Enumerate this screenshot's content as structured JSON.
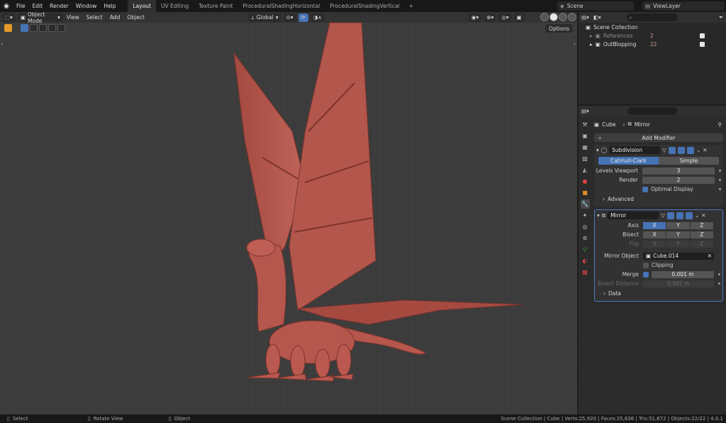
{
  "topbar": {
    "menus": [
      "File",
      "Edit",
      "Render",
      "Window",
      "Help"
    ],
    "workspaces": [
      "Layout",
      "UV Editing",
      "Texture Paint",
      "ProceduralShadingHorizontal",
      "ProceduralShadingVertical"
    ],
    "active_workspace": "Layout",
    "add_tab": "+",
    "scene": "Scene",
    "view_layer": "ViewLayer"
  },
  "viewport": {
    "mode": "Object Mode",
    "menus": [
      "View",
      "Select",
      "Add",
      "Object"
    ],
    "orientation": "Global",
    "options_label": "Options"
  },
  "outliner": {
    "root": "Scene Collection",
    "items": [
      {
        "label": "References",
        "dim": true,
        "badge": "2"
      },
      {
        "label": "OutBlopping",
        "dim": false,
        "badge": "22"
      }
    ]
  },
  "properties": {
    "breadcrumb": {
      "object": "Cube",
      "modifier": "Mirror"
    },
    "add_modifier": "Add Modifier",
    "subdivision": {
      "name": "Subdivision",
      "mode_options": [
        "Catmull-Clark",
        "Simple"
      ],
      "active_mode": "Catmull-Clark",
      "levels_viewport_label": "Levels Viewport",
      "levels_viewport": "3",
      "render_label": "Render",
      "render": "2",
      "optimal_display": "Optimal Display",
      "advanced": "Advanced"
    },
    "mirror": {
      "name": "Mirror",
      "axis_label": "Axis",
      "bisect_label": "Bisect",
      "flip_label": "Flip",
      "axes": [
        "X",
        "Y",
        "Z"
      ],
      "mirror_object_label": "Mirror Object",
      "mirror_object": "Cube.014",
      "clipping": "Clipping",
      "merge_label": "Merge",
      "merge_value": "0.001 m",
      "bisect_distance_label": "Bisect Distance",
      "bisect_distance": "0.001 m",
      "data": "Data"
    }
  },
  "statusbar": {
    "select": "Select",
    "rotate": "Rotate View",
    "object": "Object",
    "stats": "Scene Collection | Cube | Verts:25,920 | Faces:25,836 | Tris:51,672 | Objects:22/22 | 4.0.1"
  },
  "colors": {
    "accent": "#4673b5",
    "model": "#b5574d",
    "active_tool": "#e59a2a"
  }
}
